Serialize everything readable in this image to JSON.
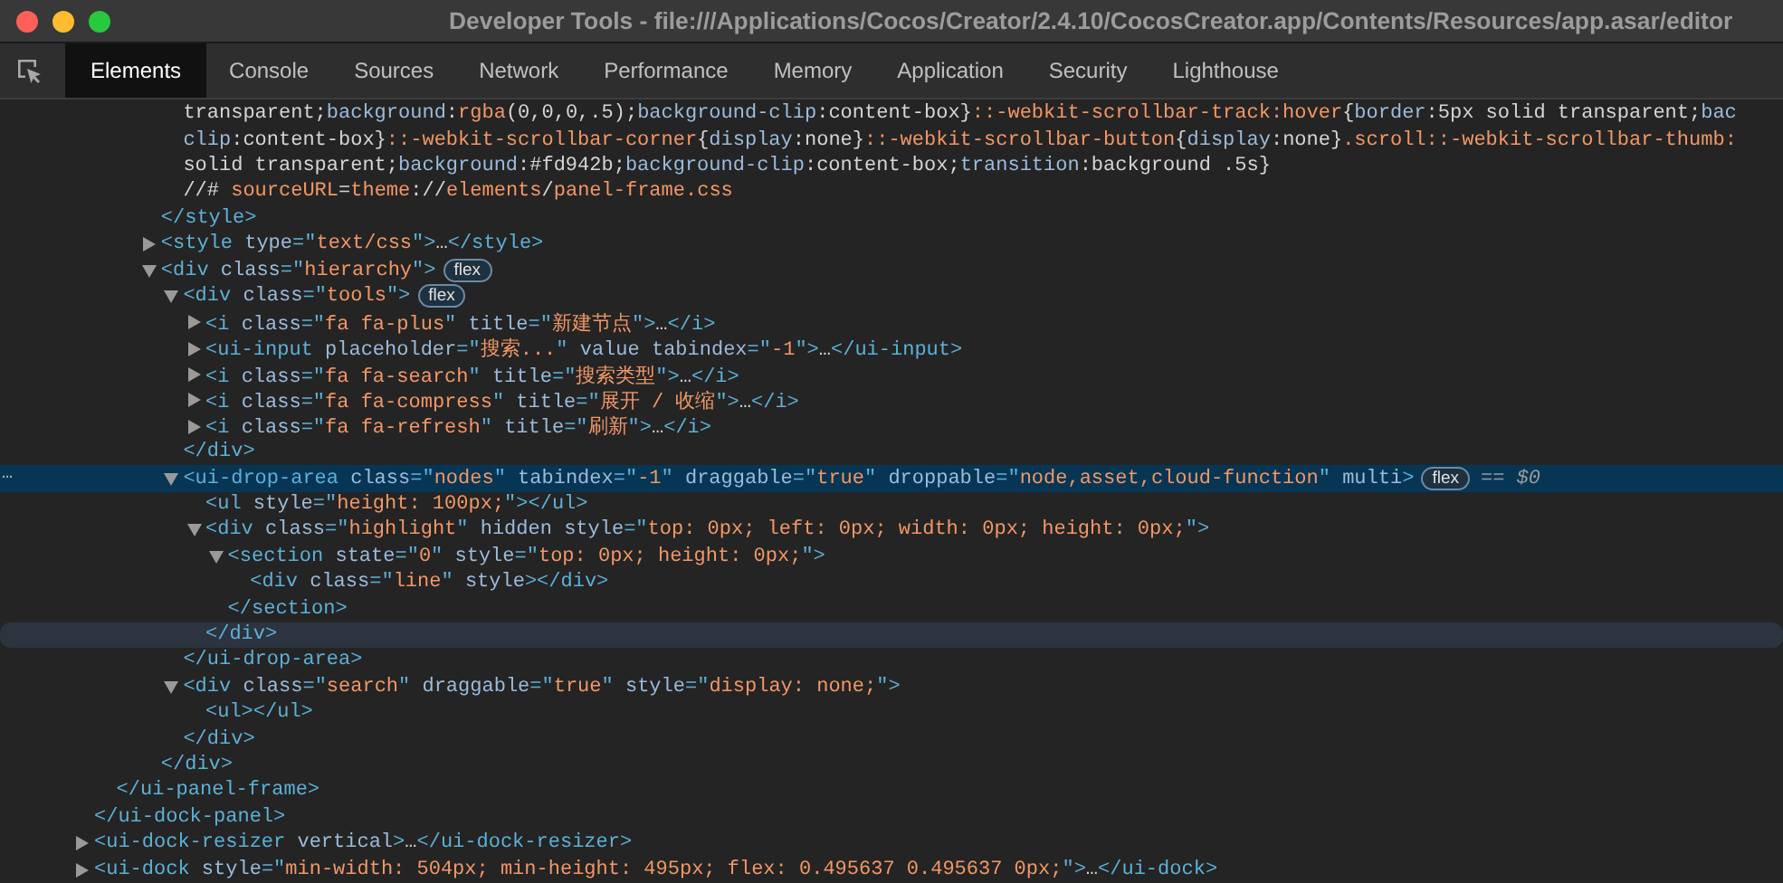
{
  "window": {
    "title": "Developer Tools - file:///Applications/Cocos/Creator/2.4.10/CocosCreator.app/Contents/Resources/app.asar/editor"
  },
  "tabs": [
    {
      "label": "Elements",
      "selected": true
    },
    {
      "label": "Console",
      "selected": false
    },
    {
      "label": "Sources",
      "selected": false
    },
    {
      "label": "Network",
      "selected": false
    },
    {
      "label": "Performance",
      "selected": false
    },
    {
      "label": "Memory",
      "selected": false
    },
    {
      "label": "Application",
      "selected": false
    },
    {
      "label": "Security",
      "selected": false
    },
    {
      "label": "Lighthouse",
      "selected": false
    }
  ],
  "tree": [
    {
      "children": [
        {
          "children": [
            {
              "children": [
                {
                  "children": [
                    {
                      "tokens": [
                        {
                          "kind": "txt",
                          "text": "transparent;"
                        },
                        {
                          "kind": "prop",
                          "text": "background"
                        },
                        {
                          "kind": "txt",
                          "text": ":"
                        },
                        {
                          "kind": "val",
                          "text": "rgba"
                        },
                        {
                          "kind": "txt",
                          "text": "(0,0,0,.5);"
                        },
                        {
                          "kind": "prop",
                          "text": "background-clip"
                        },
                        {
                          "kind": "txt",
                          "text": ":content-box}"
                        },
                        {
                          "kind": "sel",
                          "text": "::-webkit-scrollbar-track:hover"
                        },
                        {
                          "kind": "txt",
                          "text": "{"
                        },
                        {
                          "kind": "prop",
                          "text": "border"
                        },
                        {
                          "kind": "txt",
                          "text": ":5px solid transparent;"
                        },
                        {
                          "kind": "prop",
                          "text": "bac"
                        }
                      ],
                      "selected": false,
                      "hovered": false
                    },
                    {
                      "tokens": [
                        {
                          "kind": "prop",
                          "text": "clip"
                        },
                        {
                          "kind": "txt",
                          "text": ":content-box}"
                        },
                        {
                          "kind": "sel",
                          "text": "::-webkit-scrollbar-corner"
                        },
                        {
                          "kind": "txt",
                          "text": "{"
                        },
                        {
                          "kind": "prop",
                          "text": "display"
                        },
                        {
                          "kind": "txt",
                          "text": ":none}"
                        },
                        {
                          "kind": "sel",
                          "text": "::-webkit-scrollbar-button"
                        },
                        {
                          "kind": "txt",
                          "text": "{"
                        },
                        {
                          "kind": "prop",
                          "text": "display"
                        },
                        {
                          "kind": "txt",
                          "text": ":none}"
                        },
                        {
                          "kind": "sel",
                          "text": ".scroll::-webkit-scrollbar-thumb:"
                        }
                      ],
                      "selected": false,
                      "hovered": false
                    },
                    {
                      "tokens": [
                        {
                          "kind": "txt",
                          "text": "solid transparent;"
                        },
                        {
                          "kind": "prop",
                          "text": "background"
                        },
                        {
                          "kind": "txt",
                          "text": ":#fd942b;"
                        },
                        {
                          "kind": "prop",
                          "text": "background-clip"
                        },
                        {
                          "kind": "txt",
                          "text": ":content-box;"
                        },
                        {
                          "kind": "prop",
                          "text": "transition"
                        },
                        {
                          "kind": "txt",
                          "text": ":background .5s}"
                        }
                      ],
                      "selected": false,
                      "hovered": false
                    },
                    {
                      "tokens": [
                        {
                          "kind": "txt",
                          "text": "//# "
                        },
                        {
                          "kind": "val",
                          "text": "sourceURL"
                        },
                        {
                          "kind": "txt",
                          "text": "="
                        },
                        {
                          "kind": "val",
                          "text": "theme"
                        },
                        {
                          "kind": "txt",
                          "text": "://"
                        },
                        {
                          "kind": "val",
                          "text": "elements"
                        },
                        {
                          "kind": "txt",
                          "text": "/"
                        },
                        {
                          "kind": "val",
                          "text": "panel-frame.css"
                        }
                      ],
                      "selected": false,
                      "hovered": false
                    }
                  ]
                },
                {
                  "tokens": [
                    {
                      "kind": "tag",
                      "text": "</style>"
                    }
                  ],
                  "selected": false,
                  "hovered": false
                },
                {
                  "tokens": [
                    {
                      "kind": "tag",
                      "text": "<style "
                    },
                    {
                      "kind": "attr",
                      "text": "type"
                    },
                    {
                      "kind": "tag",
                      "text": "=\""
                    },
                    {
                      "kind": "val",
                      "text": "text/css"
                    },
                    {
                      "kind": "tag",
                      "text": "\">"
                    },
                    {
                      "kind": "txt",
                      "text": "…"
                    },
                    {
                      "kind": "tag",
                      "text": "</style>"
                    }
                  ],
                  "expanded": false,
                  "selected": false,
                  "hovered": false
                },
                {
                  "tokens": [
                    {
                      "kind": "tag",
                      "text": "<div "
                    },
                    {
                      "kind": "attr",
                      "text": "class"
                    },
                    {
                      "kind": "tag",
                      "text": "=\""
                    },
                    {
                      "kind": "val",
                      "text": "hierarchy"
                    },
                    {
                      "kind": "tag",
                      "text": "\">"
                    }
                  ],
                  "badge": "flex",
                  "expanded": true,
                  "selected": false,
                  "hovered": false,
                  "children": [
                    {
                      "tokens": [
                        {
                          "kind": "tag",
                          "text": "<div "
                        },
                        {
                          "kind": "attr",
                          "text": "class"
                        },
                        {
                          "kind": "tag",
                          "text": "=\""
                        },
                        {
                          "kind": "val",
                          "text": "tools"
                        },
                        {
                          "kind": "tag",
                          "text": "\">"
                        }
                      ],
                      "badge": "flex",
                      "expanded": true,
                      "selected": false,
                      "hovered": false,
                      "children": [
                        {
                          "tokens": [
                            {
                              "kind": "tag",
                              "text": "<i "
                            },
                            {
                              "kind": "attr",
                              "text": "class"
                            },
                            {
                              "kind": "tag",
                              "text": "=\""
                            },
                            {
                              "kind": "val",
                              "text": "fa fa-plus"
                            },
                            {
                              "kind": "tag",
                              "text": "\" "
                            },
                            {
                              "kind": "attr",
                              "text": "title"
                            },
                            {
                              "kind": "tag",
                              "text": "=\""
                            },
                            {
                              "kind": "val",
                              "text": "新建节点"
                            },
                            {
                              "kind": "tag",
                              "text": "\">"
                            },
                            {
                              "kind": "txt",
                              "text": "…"
                            },
                            {
                              "kind": "tag",
                              "text": "</i>"
                            }
                          ],
                          "expanded": false,
                          "selected": false,
                          "hovered": false
                        },
                        {
                          "tokens": [
                            {
                              "kind": "tag",
                              "text": "<ui-input "
                            },
                            {
                              "kind": "attr",
                              "text": "placeholder"
                            },
                            {
                              "kind": "tag",
                              "text": "=\""
                            },
                            {
                              "kind": "val",
                              "text": "搜索..."
                            },
                            {
                              "kind": "tag",
                              "text": "\" "
                            },
                            {
                              "kind": "attr",
                              "text": "value tabindex"
                            },
                            {
                              "kind": "tag",
                              "text": "=\""
                            },
                            {
                              "kind": "val",
                              "text": "-1"
                            },
                            {
                              "kind": "tag",
                              "text": "\">"
                            },
                            {
                              "kind": "txt",
                              "text": "…"
                            },
                            {
                              "kind": "tag",
                              "text": "</ui-input>"
                            }
                          ],
                          "expanded": false,
                          "selected": false,
                          "hovered": false
                        },
                        {
                          "tokens": [
                            {
                              "kind": "tag",
                              "text": "<i "
                            },
                            {
                              "kind": "attr",
                              "text": "class"
                            },
                            {
                              "kind": "tag",
                              "text": "=\""
                            },
                            {
                              "kind": "val",
                              "text": "fa fa-search"
                            },
                            {
                              "kind": "tag",
                              "text": "\" "
                            },
                            {
                              "kind": "attr",
                              "text": "title"
                            },
                            {
                              "kind": "tag",
                              "text": "=\""
                            },
                            {
                              "kind": "val",
                              "text": "搜索类型"
                            },
                            {
                              "kind": "tag",
                              "text": "\">"
                            },
                            {
                              "kind": "txt",
                              "text": "…"
                            },
                            {
                              "kind": "tag",
                              "text": "</i>"
                            }
                          ],
                          "expanded": false,
                          "selected": false,
                          "hovered": false
                        },
                        {
                          "tokens": [
                            {
                              "kind": "tag",
                              "text": "<i "
                            },
                            {
                              "kind": "attr",
                              "text": "class"
                            },
                            {
                              "kind": "tag",
                              "text": "=\""
                            },
                            {
                              "kind": "val",
                              "text": "fa fa-compress"
                            },
                            {
                              "kind": "tag",
                              "text": "\" "
                            },
                            {
                              "kind": "attr",
                              "text": "title"
                            },
                            {
                              "kind": "tag",
                              "text": "=\""
                            },
                            {
                              "kind": "val",
                              "text": "展开 / 收缩"
                            },
                            {
                              "kind": "tag",
                              "text": "\">"
                            },
                            {
                              "kind": "txt",
                              "text": "…"
                            },
                            {
                              "kind": "tag",
                              "text": "</i>"
                            }
                          ],
                          "expanded": false,
                          "selected": false,
                          "hovered": false
                        },
                        {
                          "tokens": [
                            {
                              "kind": "tag",
                              "text": "<i "
                            },
                            {
                              "kind": "attr",
                              "text": "class"
                            },
                            {
                              "kind": "tag",
                              "text": "=\""
                            },
                            {
                              "kind": "val",
                              "text": "fa fa-refresh"
                            },
                            {
                              "kind": "tag",
                              "text": "\" "
                            },
                            {
                              "kind": "attr",
                              "text": "title"
                            },
                            {
                              "kind": "tag",
                              "text": "=\""
                            },
                            {
                              "kind": "val",
                              "text": "刷新"
                            },
                            {
                              "kind": "tag",
                              "text": "\">"
                            },
                            {
                              "kind": "txt",
                              "text": "…"
                            },
                            {
                              "kind": "tag",
                              "text": "</i>"
                            }
                          ],
                          "expanded": false,
                          "selected": false,
                          "hovered": false
                        }
                      ]
                    },
                    {
                      "tokens": [
                        {
                          "kind": "tag",
                          "text": "</div>"
                        }
                      ],
                      "selected": false,
                      "hovered": false
                    },
                    {
                      "gutter": "…",
                      "tokens": [
                        {
                          "kind": "tag",
                          "text": "<ui-drop-area "
                        },
                        {
                          "kind": "attr",
                          "text": "class"
                        },
                        {
                          "kind": "tag",
                          "text": "=\""
                        },
                        {
                          "kind": "val",
                          "text": "nodes"
                        },
                        {
                          "kind": "tag",
                          "text": "\" "
                        },
                        {
                          "kind": "attr",
                          "text": "tabindex"
                        },
                        {
                          "kind": "tag",
                          "text": "=\""
                        },
                        {
                          "kind": "val",
                          "text": "-1"
                        },
                        {
                          "kind": "tag",
                          "text": "\" "
                        },
                        {
                          "kind": "attr",
                          "text": "draggable"
                        },
                        {
                          "kind": "tag",
                          "text": "=\""
                        },
                        {
                          "kind": "val",
                          "text": "true"
                        },
                        {
                          "kind": "tag",
                          "text": "\" "
                        },
                        {
                          "kind": "attr",
                          "text": "droppable"
                        },
                        {
                          "kind": "tag",
                          "text": "=\""
                        },
                        {
                          "kind": "val",
                          "text": "node,asset,cloud-function"
                        },
                        {
                          "kind": "tag",
                          "text": "\" "
                        },
                        {
                          "kind": "attr",
                          "text": "multi"
                        },
                        {
                          "kind": "tag",
                          "text": ">"
                        }
                      ],
                      "badge": "flex",
                      "suffix": "== $0",
                      "expanded": true,
                      "selected": true,
                      "hovered": false,
                      "children": [
                        {
                          "tokens": [
                            {
                              "kind": "tag",
                              "text": "<ul "
                            },
                            {
                              "kind": "attr",
                              "text": "style"
                            },
                            {
                              "kind": "tag",
                              "text": "=\""
                            },
                            {
                              "kind": "val",
                              "text": "height: 100px;"
                            },
                            {
                              "kind": "tag",
                              "text": "\"></ul>"
                            }
                          ],
                          "selected": false,
                          "hovered": false
                        },
                        {
                          "tokens": [
                            {
                              "kind": "tag",
                              "text": "<div "
                            },
                            {
                              "kind": "attr",
                              "text": "class"
                            },
                            {
                              "kind": "tag",
                              "text": "=\""
                            },
                            {
                              "kind": "val",
                              "text": "highlight"
                            },
                            {
                              "kind": "tag",
                              "text": "\" "
                            },
                            {
                              "kind": "attr",
                              "text": "hidden style"
                            },
                            {
                              "kind": "tag",
                              "text": "=\""
                            },
                            {
                              "kind": "val",
                              "text": "top: 0px; left: 0px; width: 0px; height: 0px;"
                            },
                            {
                              "kind": "tag",
                              "text": "\">"
                            }
                          ],
                          "expanded": true,
                          "selected": false,
                          "hovered": false,
                          "children": [
                            {
                              "tokens": [
                                {
                                  "kind": "tag",
                                  "text": "<section "
                                },
                                {
                                  "kind": "attr",
                                  "text": "state"
                                },
                                {
                                  "kind": "tag",
                                  "text": "=\""
                                },
                                {
                                  "kind": "val",
                                  "text": "0"
                                },
                                {
                                  "kind": "tag",
                                  "text": "\" "
                                },
                                {
                                  "kind": "attr",
                                  "text": "style"
                                },
                                {
                                  "kind": "tag",
                                  "text": "=\""
                                },
                                {
                                  "kind": "val",
                                  "text": "top: 0px; height: 0px;"
                                },
                                {
                                  "kind": "tag",
                                  "text": "\">"
                                }
                              ],
                              "expanded": true,
                              "selected": false,
                              "hovered": false,
                              "children": [
                                {
                                  "tokens": [
                                    {
                                      "kind": "tag",
                                      "text": "<div "
                                    },
                                    {
                                      "kind": "attr",
                                      "text": "class"
                                    },
                                    {
                                      "kind": "tag",
                                      "text": "=\""
                                    },
                                    {
                                      "kind": "val",
                                      "text": "line"
                                    },
                                    {
                                      "kind": "tag",
                                      "text": "\" "
                                    },
                                    {
                                      "kind": "attr",
                                      "text": "style"
                                    },
                                    {
                                      "kind": "tag",
                                      "text": "></div>"
                                    }
                                  ],
                                  "selected": false,
                                  "hovered": false
                                }
                              ]
                            },
                            {
                              "tokens": [
                                {
                                  "kind": "tag",
                                  "text": "</section>"
                                }
                              ],
                              "selected": false,
                              "hovered": false
                            }
                          ]
                        },
                        {
                          "tokens": [
                            {
                              "kind": "tag",
                              "text": "</div>"
                            }
                          ],
                          "selected": false,
                          "hovered": true
                        }
                      ]
                    },
                    {
                      "tokens": [
                        {
                          "kind": "tag",
                          "text": "</ui-drop-area>"
                        }
                      ],
                      "selected": false,
                      "hovered": false
                    },
                    {
                      "tokens": [
                        {
                          "kind": "tag",
                          "text": "<div "
                        },
                        {
                          "kind": "attr",
                          "text": "class"
                        },
                        {
                          "kind": "tag",
                          "text": "=\""
                        },
                        {
                          "kind": "val",
                          "text": "search"
                        },
                        {
                          "kind": "tag",
                          "text": "\" "
                        },
                        {
                          "kind": "attr",
                          "text": "draggable"
                        },
                        {
                          "kind": "tag",
                          "text": "=\""
                        },
                        {
                          "kind": "val",
                          "text": "true"
                        },
                        {
                          "kind": "tag",
                          "text": "\" "
                        },
                        {
                          "kind": "attr",
                          "text": "style"
                        },
                        {
                          "kind": "tag",
                          "text": "=\""
                        },
                        {
                          "kind": "val",
                          "text": "display: none;"
                        },
                        {
                          "kind": "tag",
                          "text": "\">"
                        }
                      ],
                      "expanded": true,
                      "selected": false,
                      "hovered": false,
                      "children": [
                        {
                          "tokens": [
                            {
                              "kind": "tag",
                              "text": "<ul></ul>"
                            }
                          ],
                          "selected": false,
                          "hovered": false
                        }
                      ]
                    },
                    {
                      "tokens": [
                        {
                          "kind": "tag",
                          "text": "</div>"
                        }
                      ],
                      "selected": false,
                      "hovered": false
                    }
                  ]
                },
                {
                  "tokens": [
                    {
                      "kind": "tag",
                      "text": "</div>"
                    }
                  ],
                  "selected": false,
                  "hovered": false
                }
              ]
            }
          ]
        },
        {
          "tokens": [
            {
              "kind": "tag",
              "text": "</ui-panel-frame>"
            }
          ],
          "selected": false,
          "hovered": false
        }
      ]
    },
    {
      "tokens": [
        {
          "kind": "tag",
          "text": "</ui-dock-panel>"
        }
      ],
      "selected": false,
      "hovered": false
    },
    {
      "tokens": [
        {
          "kind": "tag",
          "text": "<ui-dock-resizer "
        },
        {
          "kind": "attr",
          "text": "vertical"
        },
        {
          "kind": "tag",
          "text": ">"
        },
        {
          "kind": "txt",
          "text": "…"
        },
        {
          "kind": "tag",
          "text": "</ui-dock-resizer>"
        }
      ],
      "expanded": false,
      "selected": false,
      "hovered": false
    },
    {
      "tokens": [
        {
          "kind": "tag",
          "text": "<ui-dock "
        },
        {
          "kind": "attr",
          "text": "style"
        },
        {
          "kind": "tag",
          "text": "=\""
        },
        {
          "kind": "val",
          "text": "min-width: 504px; min-height: 495px; flex: 0.495637 0.495637 0px;"
        },
        {
          "kind": "tag",
          "text": "\">"
        },
        {
          "kind": "txt",
          "text": "…"
        },
        {
          "kind": "tag",
          "text": "</ui-dock>"
        }
      ],
      "expanded": false,
      "selected": false,
      "hovered": false
    }
  ]
}
